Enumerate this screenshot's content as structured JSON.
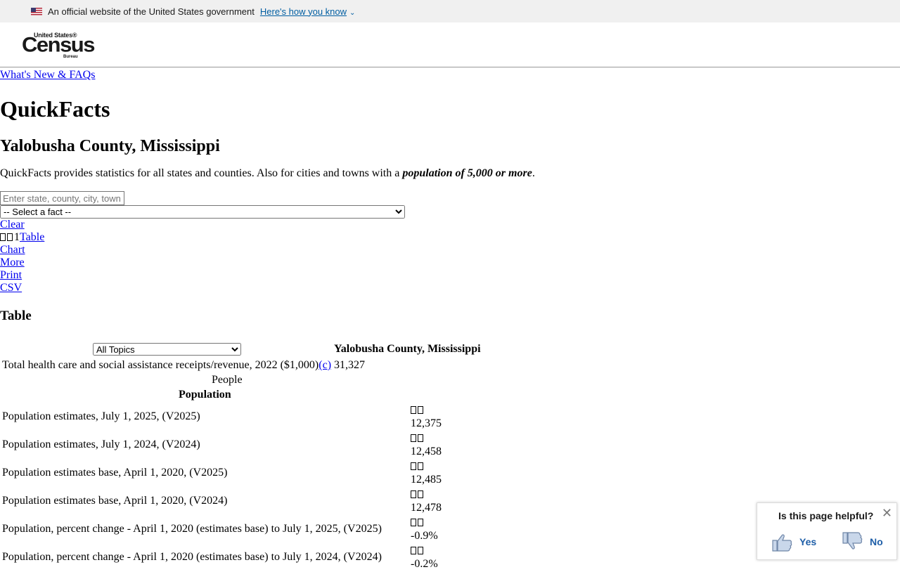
{
  "gov_banner": {
    "text": "An official website of the United States government",
    "link": "Here's how you know"
  },
  "logo": {
    "top": "United States®",
    "main": "Census",
    "sub": "Bureau"
  },
  "nav": {
    "whats_new": "What's New & FAQs"
  },
  "page": {
    "title": "QuickFacts",
    "location": "Yalobusha County, Mississippi",
    "desc_text": "QuickFacts provides statistics for all states and counties. Also for cities and towns with a ",
    "desc_emph": "population of 5,000 or more",
    "desc_end": "."
  },
  "search": {
    "placeholder": "Enter state, county, city, town, or zip code"
  },
  "fact_select": {
    "selected": "-- Select a fact --"
  },
  "actions": {
    "clear": "Clear",
    "table_prefix": "1",
    "table": "Table",
    "chart": "Chart",
    "more": "More",
    "print": "Print",
    "csv": "CSV"
  },
  "table": {
    "heading": "Table",
    "topics_selected": "All Topics",
    "column_header": "Yalobusha County, Mississippi",
    "receipts_label": "Total health care and social assistance receipts/revenue, 2022 ($1,000)",
    "receipts_note": "(c)",
    "receipts_value": "31,327",
    "section": "People",
    "subsection": "Population",
    "rows": [
      {
        "label": "Population estimates, July 1, 2025, (V2025)",
        "value": "12,375"
      },
      {
        "label": "Population estimates, July 1, 2024, (V2024)",
        "value": "12,458"
      },
      {
        "label": "Population estimates base, April 1, 2020, (V2025)",
        "value": "12,485"
      },
      {
        "label": "Population estimates base, April 1, 2020, (V2024)",
        "value": "12,478"
      },
      {
        "label": "Population, percent change - April 1, 2020 (estimates base) to July 1, 2025, (V2025)",
        "value": "-0.9%"
      },
      {
        "label": "Population, percent change - April 1, 2020 (estimates base) to July 1, 2024, (V2024)",
        "value": "-0.2%"
      }
    ]
  },
  "feedback": {
    "question": "Is this page helpful?",
    "yes": "Yes",
    "no": "No"
  }
}
